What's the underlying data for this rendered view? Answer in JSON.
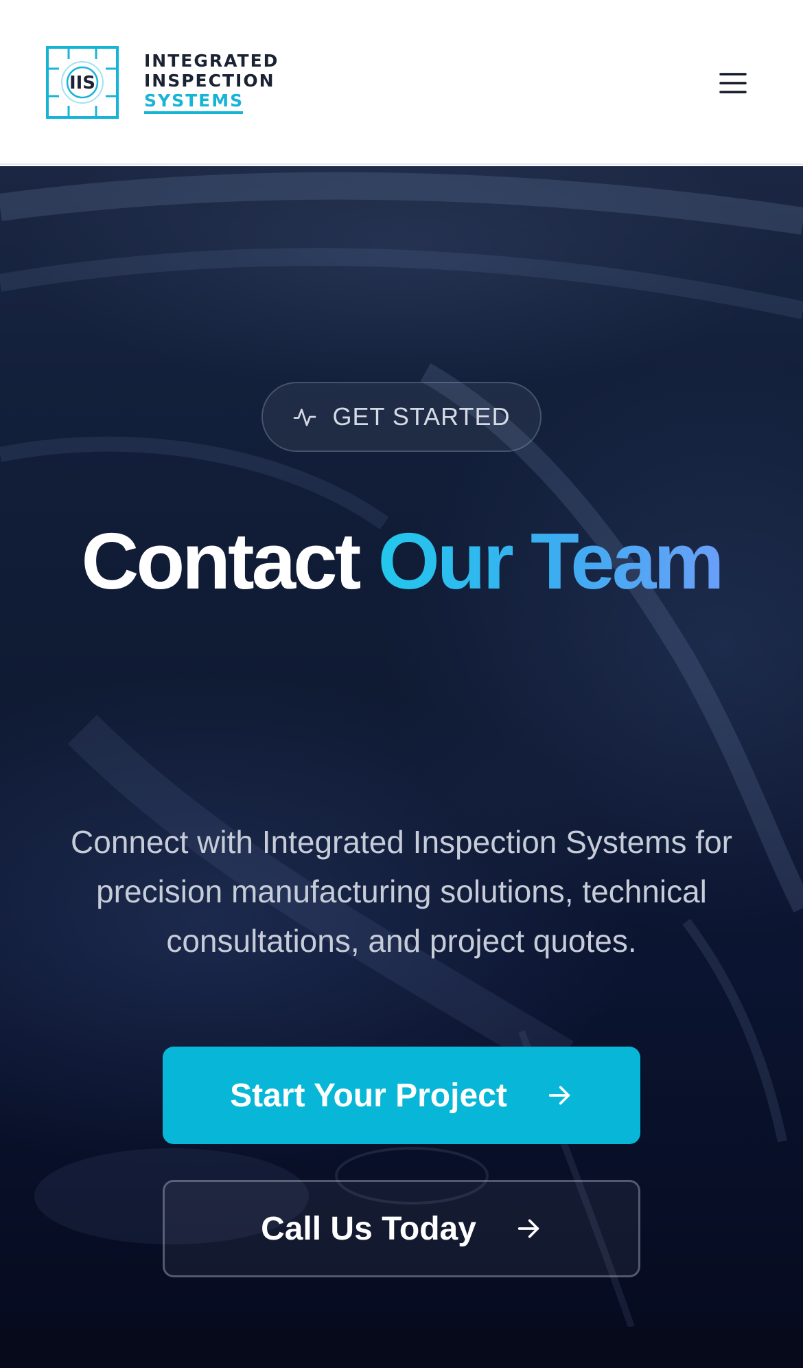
{
  "header": {
    "logo": {
      "mark_text": "IIS",
      "line1": "INTEGRATED",
      "line2": "INSPECTION",
      "line3": "SYSTEMS"
    },
    "menu_icon": "hamburger-menu-icon"
  },
  "hero": {
    "badge": {
      "icon": "activity-icon",
      "label": "GET STARTED"
    },
    "title_part1": "Contact",
    "title_part2": "Our Team",
    "description": "Connect with Integrated Inspection Systems for precision manufacturing solutions, technical consultations, and project quotes.",
    "primary_button": {
      "label": "Start Your Project",
      "icon": "arrow-right-icon"
    },
    "secondary_button": {
      "label": "Call Us Today",
      "icon": "arrow-right-icon"
    }
  },
  "colors": {
    "accent": "#08b7d8",
    "navy_text": "#1b2233",
    "hero_background": "#0f1a33",
    "gradient_end": "#6a9ff8"
  }
}
